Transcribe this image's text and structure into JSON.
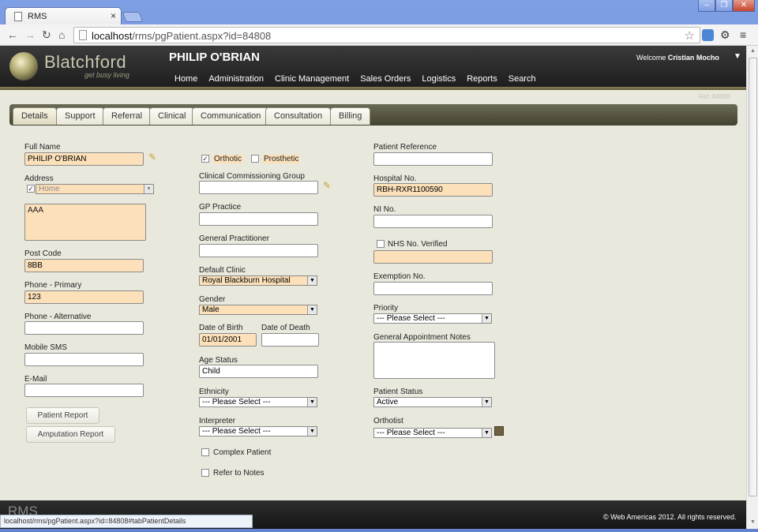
{
  "browser": {
    "tab_title": "RMS",
    "tab_close": "×",
    "url_host": "localhost",
    "url_path": "/rms/pgPatient.aspx?id=84808",
    "window_controls": [
      "‒",
      "❐",
      "✕"
    ]
  },
  "header": {
    "logo_text": "Blatchford",
    "logo_tag": "get busy living",
    "patient_name": "PHILIP O'BRIAN",
    "welcome_prefix": "Welcome ",
    "user": "Cristian Mocho",
    "menu": [
      "Home",
      "Administration",
      "Clinic Management",
      "Sales Orders",
      "Logistics",
      "Reports",
      "Search"
    ],
    "ref": "Ref.:84808"
  },
  "tabs": [
    "Details",
    "Support",
    "Referral",
    "Clinical",
    "Communication",
    "Consultation",
    "Billing"
  ],
  "col1": {
    "full_name_label": "Full Name",
    "full_name": "PHILIP O'BRIAN",
    "address_label": "Address",
    "address_type": "Home",
    "address_text": "AAA",
    "postcode_label": "Post Code",
    "postcode": "8BB",
    "phone_primary_label": "Phone - Primary",
    "phone_primary": "123",
    "phone_alt_label": "Phone - Alternative",
    "phone_alt": "",
    "mobile_label": "Mobile SMS",
    "mobile": "",
    "email_label": "E-Mail",
    "email": "",
    "patient_report_btn": "Patient Report",
    "amputation_report_btn": "Amputation Report"
  },
  "col2": {
    "orthotic_label": "Orthotic",
    "prosthetic_label": "Prosthetic",
    "ccg_label": "Clinical Commissioning Group",
    "ccg": "",
    "gp_practice_label": "GP Practice",
    "gp_practice": "",
    "gp_label": "General Practitioner",
    "gp": "",
    "default_clinic_label": "Default Clinic",
    "default_clinic": "Royal Blackburn Hospital",
    "gender_label": "Gender",
    "gender": "Male",
    "dob_label": "Date of Birth",
    "dob": "01/01/2001",
    "dod_label": "Date of Death",
    "dod": "",
    "age_status_label": "Age Status",
    "age_status": "Child",
    "ethnicity_label": "Ethnicity",
    "ethnicity": "--- Please Select ---",
    "interpreter_label": "Interpreter",
    "interpreter": "--- Please Select ---",
    "complex_label": "Complex Patient",
    "refer_label": "Refer to Notes"
  },
  "col3": {
    "patient_ref_label": "Patient Reference",
    "patient_ref": "",
    "hospital_no_label": "Hospital No.",
    "hospital_no": "RBH-RXR1100590",
    "ni_label": "NI No.",
    "ni": "",
    "nhs_label": "NHS No. Verified",
    "nhs": "",
    "exemption_label": "Exemption No.",
    "exemption": "",
    "priority_label": "Priority",
    "priority": "--- Please Select ---",
    "gan_label": "General Appointment Notes",
    "gan": "",
    "status_label": "Patient Status",
    "status": "Active",
    "orthotist_label": "Orthotist",
    "orthotist": "--- Please Select ---"
  },
  "footer": {
    "brand": "RMS",
    "copyright": "© Web Americas 2012. All rights reserved."
  },
  "statusbar": "localhost/rms/pgPatient.aspx?id=84808#tabPatientDetails"
}
